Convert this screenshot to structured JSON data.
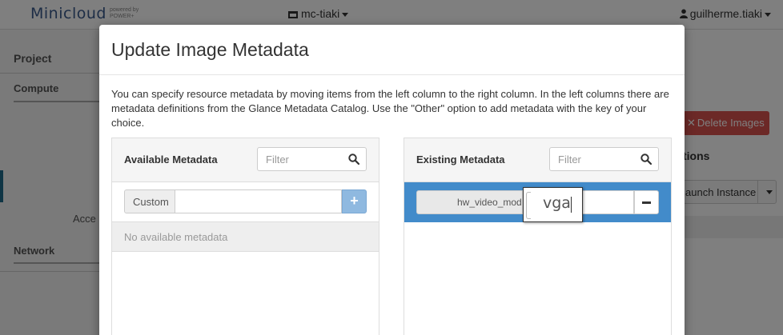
{
  "app": {
    "brand": "Minicloud",
    "brand_sub_1": "powered by",
    "brand_sub_2": "POWER+",
    "project": "mc-tiaki",
    "user": "guilherme.tiaki"
  },
  "sidebar": {
    "project": "Project",
    "compute": "Compute",
    "access": "Acce",
    "network": "Network"
  },
  "background": {
    "delete_images": "Delete Images",
    "actions_title": "tions",
    "launch_instance": "aunch Instance"
  },
  "modal": {
    "title": "Update Image Metadata",
    "description": "You can specify resource metadata by moving items from the left column to the right column. In the left columns there are metadata definitions from the Glance Metadata Catalog. Use the \"Other\" option to add metadata with the key of your choice.",
    "available": {
      "title": "Available Metadata",
      "filter_placeholder": "Filter",
      "custom_label": "Custom",
      "custom_value": "",
      "add_label": "+",
      "empty_text": "No available metadata"
    },
    "existing": {
      "title": "Existing Metadata",
      "filter_placeholder": "Filter",
      "items": [
        {
          "key": "hw_video_model",
          "value": "vga"
        }
      ]
    }
  },
  "colors": {
    "accent": "#428bca",
    "danger": "#d9534f",
    "brand": "#3a5a8c"
  },
  "icons": {
    "filter": "search-icon",
    "user": "user-icon",
    "delete": "close-icon",
    "remove": "minus-icon"
  }
}
